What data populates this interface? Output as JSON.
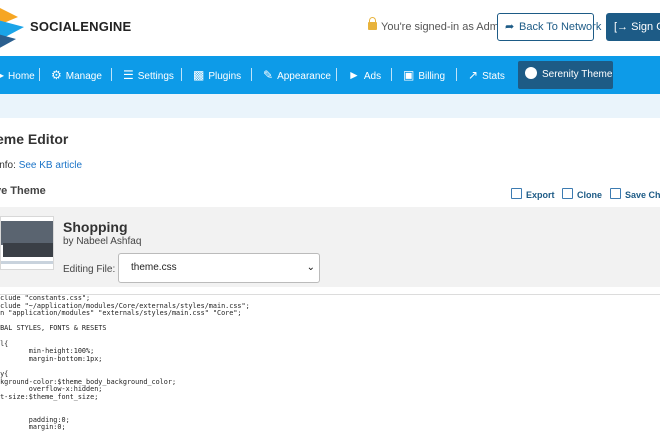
{
  "header": {
    "brand": "SOCIALENGINE",
    "signed_in": "You're signed-in as Admin",
    "back_button": "Back To Network",
    "signout_button": "Sign Ou"
  },
  "nav": {
    "items": [
      {
        "label": "Home",
        "icon": "home-icon"
      },
      {
        "label": "Manage",
        "icon": "cogs-icon"
      },
      {
        "label": "Settings",
        "icon": "sliders-icon"
      },
      {
        "label": "Plugins",
        "icon": "puzzle-icon"
      },
      {
        "label": "Appearance",
        "icon": "brush-icon"
      },
      {
        "label": "Ads",
        "icon": "megaphone-icon"
      },
      {
        "label": "Billing",
        "icon": "money-icon"
      },
      {
        "label": "Stats",
        "icon": "chart-icon"
      }
    ],
    "active": {
      "label": "Serenity Theme",
      "icon": "dashboard-icon"
    }
  },
  "page": {
    "title": "eme Editor",
    "info_prefix": "info: ",
    "info_link": "See KB article",
    "active_theme": "ve Theme",
    "actions": {
      "export": "Export",
      "clone": "Clone",
      "save": "Save Chan"
    }
  },
  "theme": {
    "name": "Shopping",
    "author": "by Nabeel Ashfaq",
    "editing_label": "Editing File:",
    "file_selected": "theme.css"
  },
  "code": "nclude \"constants.css\";\nnclude \"~/application/modules/Core/externals/styles/main.css\";\nan \"application/modules\" \"externals/styles/main.css\" \"Core\";\n\nOBAL STYLES, FONTS & RESETS\n\nml{\n        min-height:100%;\n        margin-bottom:1px;\n\ndy{\nckground-color:$theme_body_background_color;\n        overflow-x:hidden;\nnt-size:$theme_font_size;\n\n\n        padding:0;\n        margin:0;"
}
